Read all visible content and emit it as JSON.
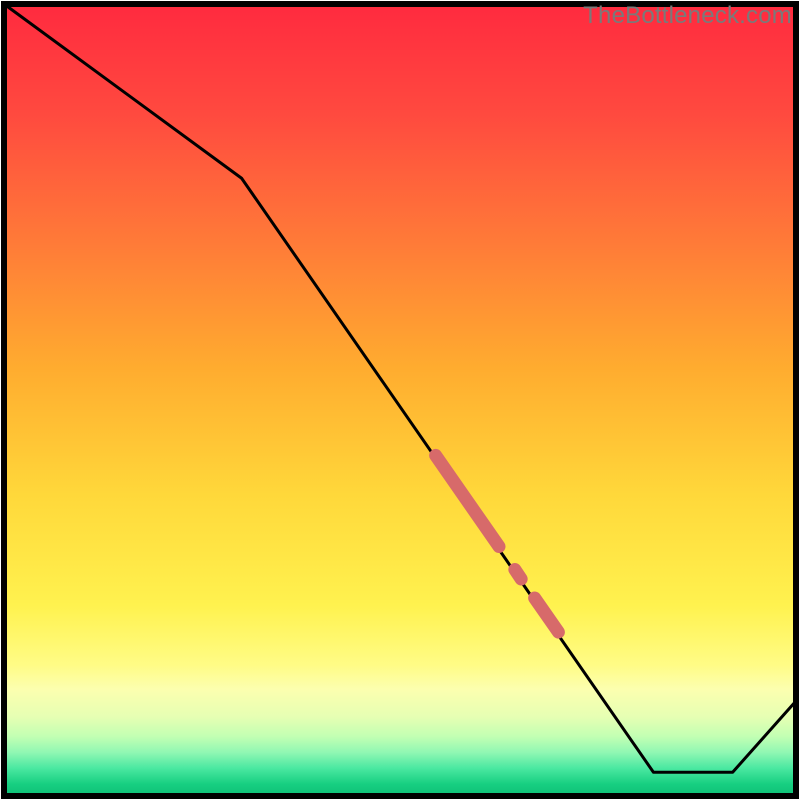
{
  "watermark": "TheBottleneck.com",
  "chart_data": {
    "type": "line",
    "title": "",
    "xlabel": "",
    "ylabel": "",
    "xlim": [
      0,
      100
    ],
    "ylim": [
      0,
      100
    ],
    "grid": false,
    "legend": false,
    "line_points": [
      {
        "x": 0,
        "y": 100
      },
      {
        "x": 30,
        "y": 78
      },
      {
        "x": 82,
        "y": 3
      },
      {
        "x": 92,
        "y": 3
      },
      {
        "x": 100,
        "y": 12
      }
    ],
    "highlight_segments": [
      {
        "x0": 54.5,
        "y0": 43.0,
        "x1": 62.5,
        "y1": 31.5
      },
      {
        "x0": 64.5,
        "y0": 28.6,
        "x1": 65.3,
        "y1": 27.4
      },
      {
        "x0": 67.0,
        "y0": 25.0,
        "x1": 70.0,
        "y1": 20.7
      }
    ],
    "highlight_color": "#d76a6a",
    "gradient_bands": [
      {
        "offset": 0.0,
        "color": "#ff2a3f"
      },
      {
        "offset": 0.14,
        "color": "#ff4a3f"
      },
      {
        "offset": 0.3,
        "color": "#ff7a38"
      },
      {
        "offset": 0.46,
        "color": "#ffac2f"
      },
      {
        "offset": 0.62,
        "color": "#ffd83a"
      },
      {
        "offset": 0.76,
        "color": "#fff24f"
      },
      {
        "offset": 0.835,
        "color": "#fffc86"
      },
      {
        "offset": 0.865,
        "color": "#fcffaf"
      },
      {
        "offset": 0.9,
        "color": "#e6ffb3"
      },
      {
        "offset": 0.925,
        "color": "#c2ffb3"
      },
      {
        "offset": 0.945,
        "color": "#90f7b3"
      },
      {
        "offset": 0.965,
        "color": "#4ae8a1"
      },
      {
        "offset": 0.985,
        "color": "#17cf81"
      },
      {
        "offset": 1.0,
        "color": "#0fbf77"
      }
    ]
  }
}
